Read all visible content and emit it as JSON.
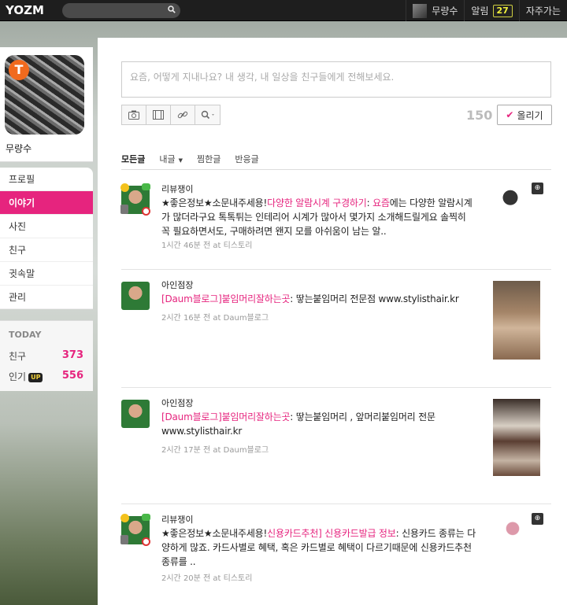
{
  "topbar": {
    "logo": "YOZM",
    "user_name": "무량수",
    "alarm_label": "알림",
    "alarm_count": "27",
    "favorites_label": "자주가는"
  },
  "profile": {
    "name": "무량수",
    "badge": "T"
  },
  "nav": {
    "items": [
      {
        "label": "프로필"
      },
      {
        "label": "이야기"
      },
      {
        "label": "사진"
      },
      {
        "label": "친구"
      },
      {
        "label": "귓속말"
      },
      {
        "label": "관리"
      }
    ]
  },
  "today": {
    "title": "TODAY",
    "friends_label": "친구",
    "friends_value": "373",
    "popular_label": "인기",
    "popular_badge": "UP",
    "popular_value": "556"
  },
  "compose": {
    "placeholder": "요즘, 어떻게 지내나요? 내 생각, 내 일상을 친구들에게 전해보세요.",
    "char_count": "150",
    "post_label": "올리기",
    "post_check": "✔"
  },
  "tabs": [
    {
      "label": "모든글"
    },
    {
      "label": "내글",
      "caret": "▼"
    },
    {
      "label": "찜한글"
    },
    {
      "label": "반응글"
    }
  ],
  "feed": [
    {
      "author": "리뷰쟁이",
      "text_parts": [
        "★좋은정보★소문내주세용!",
        "다양한 알람시계 구경하기",
        ": ",
        "요즘",
        "에는 다양한 알람시계가 많더라구요 톡톡튀는 인테리어 시계가 많아서 몇가지 소개해드릴게요 솔찍히 꼭 필요하면서도, 구매하려면 왠지 모를 아쉬움이 남는 알.."
      ],
      "meta": "1시간 46분 전 at 티스토리"
    },
    {
      "author": "아인점장",
      "text_parts": [
        "[Daum블로그]붙임머리잘하는곳",
        ": 땋는붙임머리 전문점 www.stylisthair.kr"
      ],
      "meta": "2시간 16분 전 at Daum블로그"
    },
    {
      "author": "아인점장",
      "text_parts": [
        "[Daum블로그]붙임머리잘하는곳",
        ": 땋는붙임머리 , 앞머리붙임머리 전문 www.stylisthair.kr"
      ],
      "meta": "2시간 17분 전 at Daum블로그"
    },
    {
      "author": "리뷰쟁이",
      "text_parts": [
        "★좋은정보★소문내주세용!",
        "신용카드추천] 신용카드발급 정보",
        ": 신용카드 종류는 다양하게 많죠. 카드사별로 혜택, 혹은 카드별로 혜택이 다르기때문에 신용카드추천 종류를 .."
      ],
      "meta": "2시간 20분 전 at 티스토리"
    }
  ],
  "thumb_zoom": "⊕"
}
